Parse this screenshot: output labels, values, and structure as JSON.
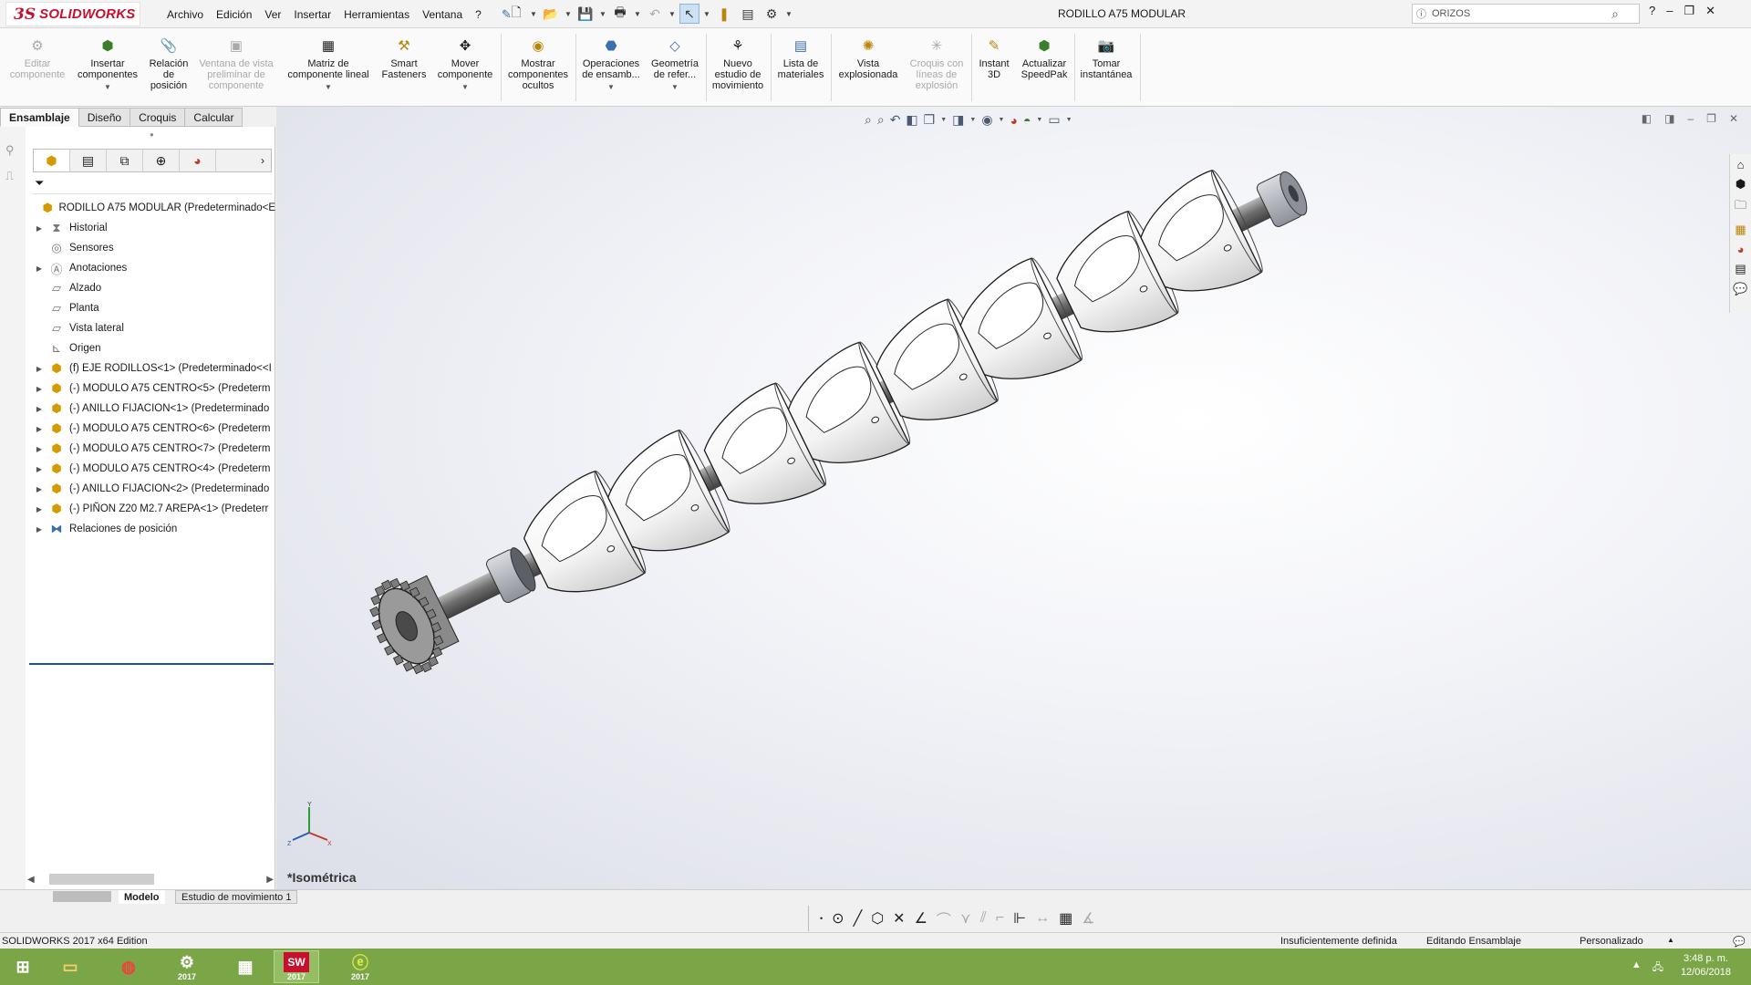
{
  "app": {
    "logo_ds": "3S",
    "logo_text": "SOLIDWORKS",
    "document_title": "RODILLO A75 MODULAR",
    "menus": [
      "Archivo",
      "Edición",
      "Ver",
      "Insertar",
      "Herramientas",
      "Ventana",
      "?"
    ],
    "search_placeholder": "ORIZOS"
  },
  "command_manager": {
    "buttons": [
      {
        "label": "Editar\ncomponente",
        "icon": "edit-component-icon",
        "enabled": false
      },
      {
        "label": "Insertar\ncomponentes",
        "icon": "insert-components-icon",
        "enabled": true
      },
      {
        "label": "Relación\nde\nposición",
        "icon": "mate-icon",
        "enabled": true
      },
      {
        "label": "Ventana de vista\npreliminar de\ncomponente",
        "icon": "preview-window-icon",
        "enabled": false
      },
      {
        "label": "Matriz de\ncomponente lineal",
        "icon": "linear-pattern-icon",
        "enabled": true
      },
      {
        "label": "Smart\nFasteners",
        "icon": "smart-fasteners-icon",
        "enabled": true
      },
      {
        "label": "Mover\ncomponente",
        "icon": "move-component-icon",
        "enabled": true
      },
      {
        "label": "Mostrar\ncomponentes\nocultos",
        "icon": "show-hidden-icon",
        "enabled": true
      },
      {
        "label": "Operaciones\nde ensamb...",
        "icon": "assembly-features-icon",
        "enabled": true
      },
      {
        "label": "Geometría\nde refer...",
        "icon": "reference-geometry-icon",
        "enabled": true
      },
      {
        "label": "Nuevo\nestudio de\nmovimiento",
        "icon": "motion-study-icon",
        "enabled": true
      },
      {
        "label": "Lista de\nmateriales",
        "icon": "bom-icon",
        "enabled": true
      },
      {
        "label": "Vista\nexplosionada",
        "icon": "exploded-view-icon",
        "enabled": true
      },
      {
        "label": "Croquis con\nlíneas de\nexplosión",
        "icon": "explode-line-sketch-icon",
        "enabled": false
      },
      {
        "label": "Instant\n3D",
        "icon": "instant3d-icon",
        "enabled": true
      },
      {
        "label": "Actualizar\nSpeedPak",
        "icon": "speedpak-icon",
        "enabled": true
      },
      {
        "label": "Tomar\ninstantánea",
        "icon": "snapshot-icon",
        "enabled": true
      }
    ],
    "tabs": [
      "Ensamblaje",
      "Diseño",
      "Croquis",
      "Calcular"
    ],
    "active_tab": "Ensamblaje"
  },
  "feature_tree": {
    "root": "RODILLO A75 MODULAR  (Predeterminado<E",
    "items": [
      {
        "label": "Historial",
        "expandable": true,
        "icon": "history-icon"
      },
      {
        "label": "Sensores",
        "expandable": false,
        "icon": "sensor-icon"
      },
      {
        "label": "Anotaciones",
        "expandable": true,
        "icon": "annotations-icon"
      },
      {
        "label": "Alzado",
        "expandable": false,
        "icon": "plane-icon"
      },
      {
        "label": "Planta",
        "expandable": false,
        "icon": "plane-icon"
      },
      {
        "label": "Vista lateral",
        "expandable": false,
        "icon": "plane-icon"
      },
      {
        "label": "Origen",
        "expandable": false,
        "icon": "origin-icon"
      },
      {
        "label": "(f) EJE RODILLOS<1> (Predeterminado<<I",
        "expandable": true,
        "icon": "part-icon"
      },
      {
        "label": "(-) MODULO A75 CENTRO<5> (Predeterm",
        "expandable": true,
        "icon": "part-icon"
      },
      {
        "label": "(-) ANILLO FIJACION<1> (Predeterminado",
        "expandable": true,
        "icon": "part-icon"
      },
      {
        "label": "(-) MODULO A75 CENTRO<6> (Predeterm",
        "expandable": true,
        "icon": "part-icon"
      },
      {
        "label": "(-) MODULO A75 CENTRO<7> (Predeterm",
        "expandable": true,
        "icon": "part-icon"
      },
      {
        "label": "(-) MODULO A75 CENTRO<4> (Predeterm",
        "expandable": true,
        "icon": "part-icon"
      },
      {
        "label": "(-) ANILLO FIJACION<2> (Predeterminado",
        "expandable": true,
        "icon": "part-icon"
      },
      {
        "label": "(-) PIÑON Z20 M2.7 AREPA<1> (Predeterr",
        "expandable": true,
        "icon": "subassembly-icon"
      },
      {
        "label": "Relaciones de posición",
        "expandable": true,
        "icon": "mates-folder-icon"
      }
    ]
  },
  "viewport": {
    "view_name": "*Isométrica"
  },
  "bottom_tabs": {
    "model": "Modelo",
    "motion": "Estudio de movimiento 1"
  },
  "status_bar": {
    "edition": "SOLIDWORKS 2017 x64 Edition",
    "definition": "Insuficientemente definida",
    "mode": "Editando Ensamblaje",
    "units": "Personalizado"
  },
  "taskbar": {
    "items": [
      {
        "name": "start",
        "label": ""
      },
      {
        "name": "file-explorer",
        "label": ""
      },
      {
        "name": "chrome",
        "label": ""
      },
      {
        "name": "sw-app-2017",
        "label": "2017"
      },
      {
        "name": "calculator",
        "label": ""
      },
      {
        "name": "solidworks-2017",
        "label": "2017"
      },
      {
        "name": "edrawings-2017",
        "label": "2017"
      }
    ],
    "time": "3:48 p. m.",
    "date": "12/06/2018"
  },
  "colors": {
    "brand_red": "#c8102e",
    "taskbar_green": "#7ba647",
    "tree_selection": "#1f4f9a"
  }
}
